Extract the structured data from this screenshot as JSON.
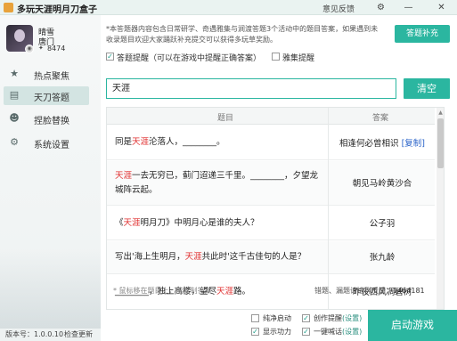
{
  "window": {
    "title": "多玩天涯明月刀盒子",
    "feedback": "意见反馈",
    "settings_icon": "gear-icon",
    "minimize_icon": "minimize-icon",
    "close_icon": "close-icon"
  },
  "user": {
    "name": "晴雪",
    "faction": "唐门",
    "score": "8474"
  },
  "sidebar": {
    "items": [
      {
        "label": "热点聚焦",
        "icon": "star-icon"
      },
      {
        "label": "天刀答题",
        "icon": "book-icon"
      },
      {
        "label": "捏脸替换",
        "icon": "mask-icon"
      },
      {
        "label": "系统设置",
        "icon": "gear-icon"
      }
    ],
    "active_index": 1,
    "version": "版本号：1.0.0.10",
    "check_update": "检查更新"
  },
  "notice": {
    "text": "*本答题器内容包含日常研学、奇遇雅集与涧渡答题3个活动中的题目答案，如果遇到未收录题目欢迎大家踊跃补充提交可以获得多玩草奖励。",
    "supplement_button": "答题补充"
  },
  "options": {
    "answer_prompt": {
      "label": "答题提醒（可以在游戏中提醒正确答案）",
      "checked": true
    },
    "yaji_prompt": {
      "label": "雅集提醒",
      "checked": false
    }
  },
  "search": {
    "value": "天涯",
    "clear_button": "清空"
  },
  "table": {
    "headers": {
      "question": "题目",
      "answer": "答案"
    },
    "rows": [
      {
        "q_before": "同是",
        "q_hl": "天涯",
        "q_after": "沦落人，________。",
        "answer": "相逢何必曾相识",
        "copy": "[复制]"
      },
      {
        "q_before": "",
        "q_hl": "天涯",
        "q_after": "一去无穷已，蓟门迢递三千里。________，夕望龙城阵云起。",
        "answer": "朝见马岭黄沙合",
        "copy": ""
      },
      {
        "q_before": "《",
        "q_hl": "天涯",
        "q_after": "明月刀》中明月心是谁的夫人？",
        "answer": "公子羽",
        "copy": ""
      },
      {
        "q_before": "写出'海上生明月，",
        "q_hl": "天涯",
        "q_after": "共此时'这千古佳句的人是？",
        "answer": "张九龄",
        "copy": ""
      },
      {
        "q_before": "________，独上高楼，望尽",
        "q_hl": "天涯",
        "q_after": "路。",
        "answer": "昨夜西风凋碧树",
        "copy": ""
      }
    ]
  },
  "footer": {
    "hint": "* 鼠标移在题目上，能复制答案",
    "report_label": "错题、漏题请进群反馈：",
    "report_qq": "1464181",
    "opts": [
      {
        "label": "纯净启动",
        "checked": false,
        "settings": ""
      },
      {
        "label": "创作提醒",
        "checked": true,
        "settings": "(设置)"
      },
      {
        "label": "显示功力",
        "checked": true,
        "settings": ""
      },
      {
        "label": "一键喊话",
        "checked": true,
        "settings": "(设置)"
      }
    ],
    "launch_button": "启动游戏"
  },
  "colors": {
    "accent": "#2bb6a0",
    "highlight": "#e03030",
    "link": "#2a63c9"
  }
}
